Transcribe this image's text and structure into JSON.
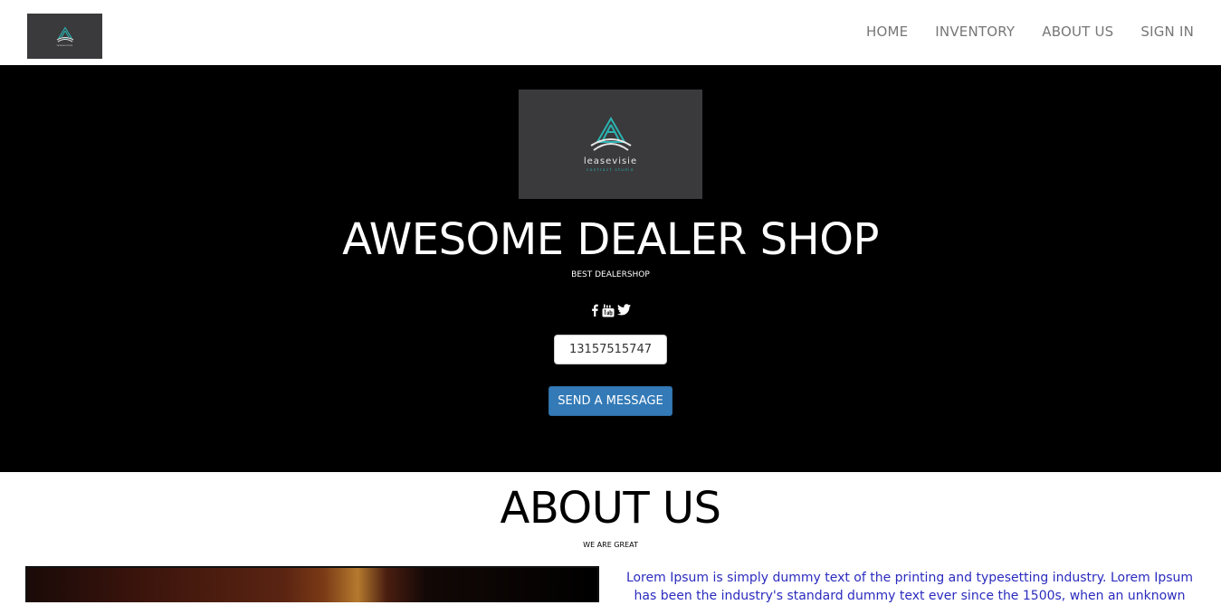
{
  "nav": {
    "brand_mini": "leasevisie",
    "links": [
      "HOME",
      "INVENTORY",
      "ABOUT US",
      "SIGN IN"
    ]
  },
  "hero": {
    "brand_name": "leasevisie",
    "brand_tagline": "contract studio",
    "title": "AWESOME DEALER SHOP",
    "subtitle": "BEST DEALERSHOP",
    "social_icons": [
      "facebook-icon",
      "youtube-icon",
      "twitter-icon"
    ],
    "phone": "13157515747",
    "send_button": "SEND A MESSAGE"
  },
  "about": {
    "title": "ABOUT US",
    "subtitle": "WE ARE GREAT",
    "text": "Lorem Ipsum is simply dummy text of the printing and typesetting industry. Lorem Ipsum has been the industry's standard dummy text ever since the 1500s, when an unknown"
  },
  "colors": {
    "hero_bg": "#000000",
    "logo_bg": "#3a3a3c",
    "accent_teal": "#2bb3b1",
    "button_blue": "#337ab7",
    "nav_text": "#777777",
    "about_text": "#2b2bbf"
  }
}
